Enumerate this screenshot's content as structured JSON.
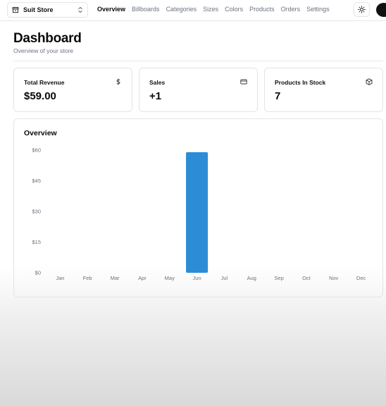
{
  "navbar": {
    "store_name": "Suit Store",
    "links": [
      {
        "label": "Overview",
        "active": true
      },
      {
        "label": "Billboards",
        "active": false
      },
      {
        "label": "Categories",
        "active": false
      },
      {
        "label": "Sizes",
        "active": false
      },
      {
        "label": "Colors",
        "active": false
      },
      {
        "label": "Products",
        "active": false
      },
      {
        "label": "Orders",
        "active": false
      },
      {
        "label": "Settings",
        "active": false
      }
    ],
    "theme_icon": "sun-icon"
  },
  "header": {
    "title": "Dashboard",
    "subtitle": "Overview of your store"
  },
  "stats": [
    {
      "label": "Total Revenue",
      "value": "$59.00",
      "icon": "dollar-icon"
    },
    {
      "label": "Sales",
      "value": "+1",
      "icon": "credit-card-icon"
    },
    {
      "label": "Products In Stock",
      "value": "7",
      "icon": "package-icon"
    }
  ],
  "overview": {
    "title": "Overview"
  },
  "chart_data": {
    "type": "bar",
    "categories": [
      "Jan",
      "Feb",
      "Mar",
      "Apr",
      "May",
      "Jun",
      "Jul",
      "Aug",
      "Sep",
      "Oct",
      "Nov",
      "Dec"
    ],
    "values": [
      0,
      0,
      0,
      0,
      0,
      59,
      0,
      0,
      0,
      0,
      0,
      0
    ],
    "yticks": [
      "$0",
      "$15",
      "$30",
      "$45",
      "$60"
    ],
    "ylim": [
      0,
      60
    ],
    "grid": false,
    "bar_color": "#2d8cd6"
  },
  "colors": {
    "accent_bar": "#2d8cd6",
    "muted_text": "#6b7280"
  }
}
